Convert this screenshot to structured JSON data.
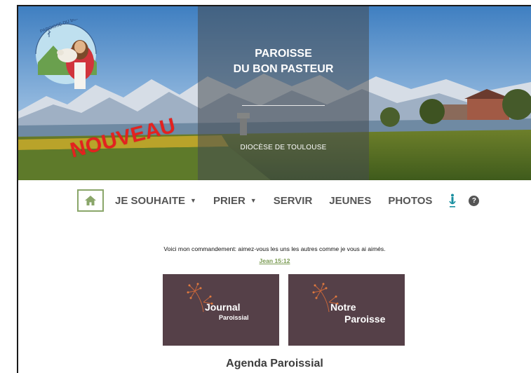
{
  "header": {
    "title_line1": "PAROISSE",
    "title_line2": "DU BON PASTEUR",
    "diocese": "DIOCÈSE DE TOULOUSE",
    "badge": "NOUVEAU",
    "logo_text": "PAROISSE DU BON PASTEUR - AUTERIVE"
  },
  "nav": {
    "home_icon": "home-icon",
    "items": [
      {
        "label": "JE SOUHAITE",
        "dropdown": true
      },
      {
        "label": "PRIER",
        "dropdown": true
      },
      {
        "label": "SERVIR",
        "dropdown": false
      },
      {
        "label": "JEUNES",
        "dropdown": false
      },
      {
        "label": "PHOTOS",
        "dropdown": false
      }
    ],
    "accessibility_icon": "accessibility-icon",
    "help_icon": "help-icon",
    "help_glyph": "?"
  },
  "verse": {
    "text": "Voici mon commandement: aimez-vous les uns les autres comme je vous ai aimés.",
    "reference": "Jean 15:12"
  },
  "cards": [
    {
      "line1": "Journal",
      "line2": "Paroissial"
    },
    {
      "line1": "Notre",
      "line2": "Paroisse"
    }
  ],
  "agenda_title": "Agenda Paroissial",
  "colors": {
    "accent_green": "#8aa66a",
    "card_bg": "#554048",
    "badge_red": "#e3221f",
    "access_teal": "#1a8fa0"
  }
}
